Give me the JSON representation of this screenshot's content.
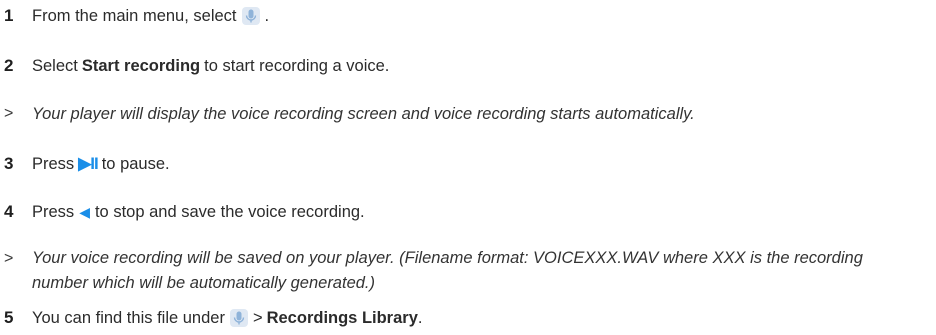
{
  "steps": [
    {
      "number": "1",
      "before": "From the main menu, select",
      "after": "."
    },
    {
      "number": "2",
      "before": "Select",
      "bold": "Start recording",
      "after": "to start recording a voice."
    },
    {
      "number": "3",
      "before": "Press",
      "glyph": "▶II",
      "after": "to pause."
    },
    {
      "number": "4",
      "before": "Press",
      "glyph": "◀",
      "after": "to stop and save the voice recording."
    },
    {
      "number": "5",
      "before": "You can find this file under",
      "between": ">",
      "bold": "Recordings Library",
      "after": "."
    }
  ],
  "notes": [
    {
      "marker": ">",
      "text": "Your player will display the voice recording screen and voice recording starts automatically."
    },
    {
      "marker": ">",
      "text": "Your voice recording will be saved on your player. (Filename format: VOICEXXX.WAV where XXX is the recording number which will be automatically generated.)"
    }
  ],
  "icons": {
    "voice": "microphone-icon",
    "play_pause": "play-pause-icon",
    "back": "back-arrow-icon"
  },
  "colors": {
    "accent": "#1a8ee8",
    "text": "#2b2b2b"
  }
}
